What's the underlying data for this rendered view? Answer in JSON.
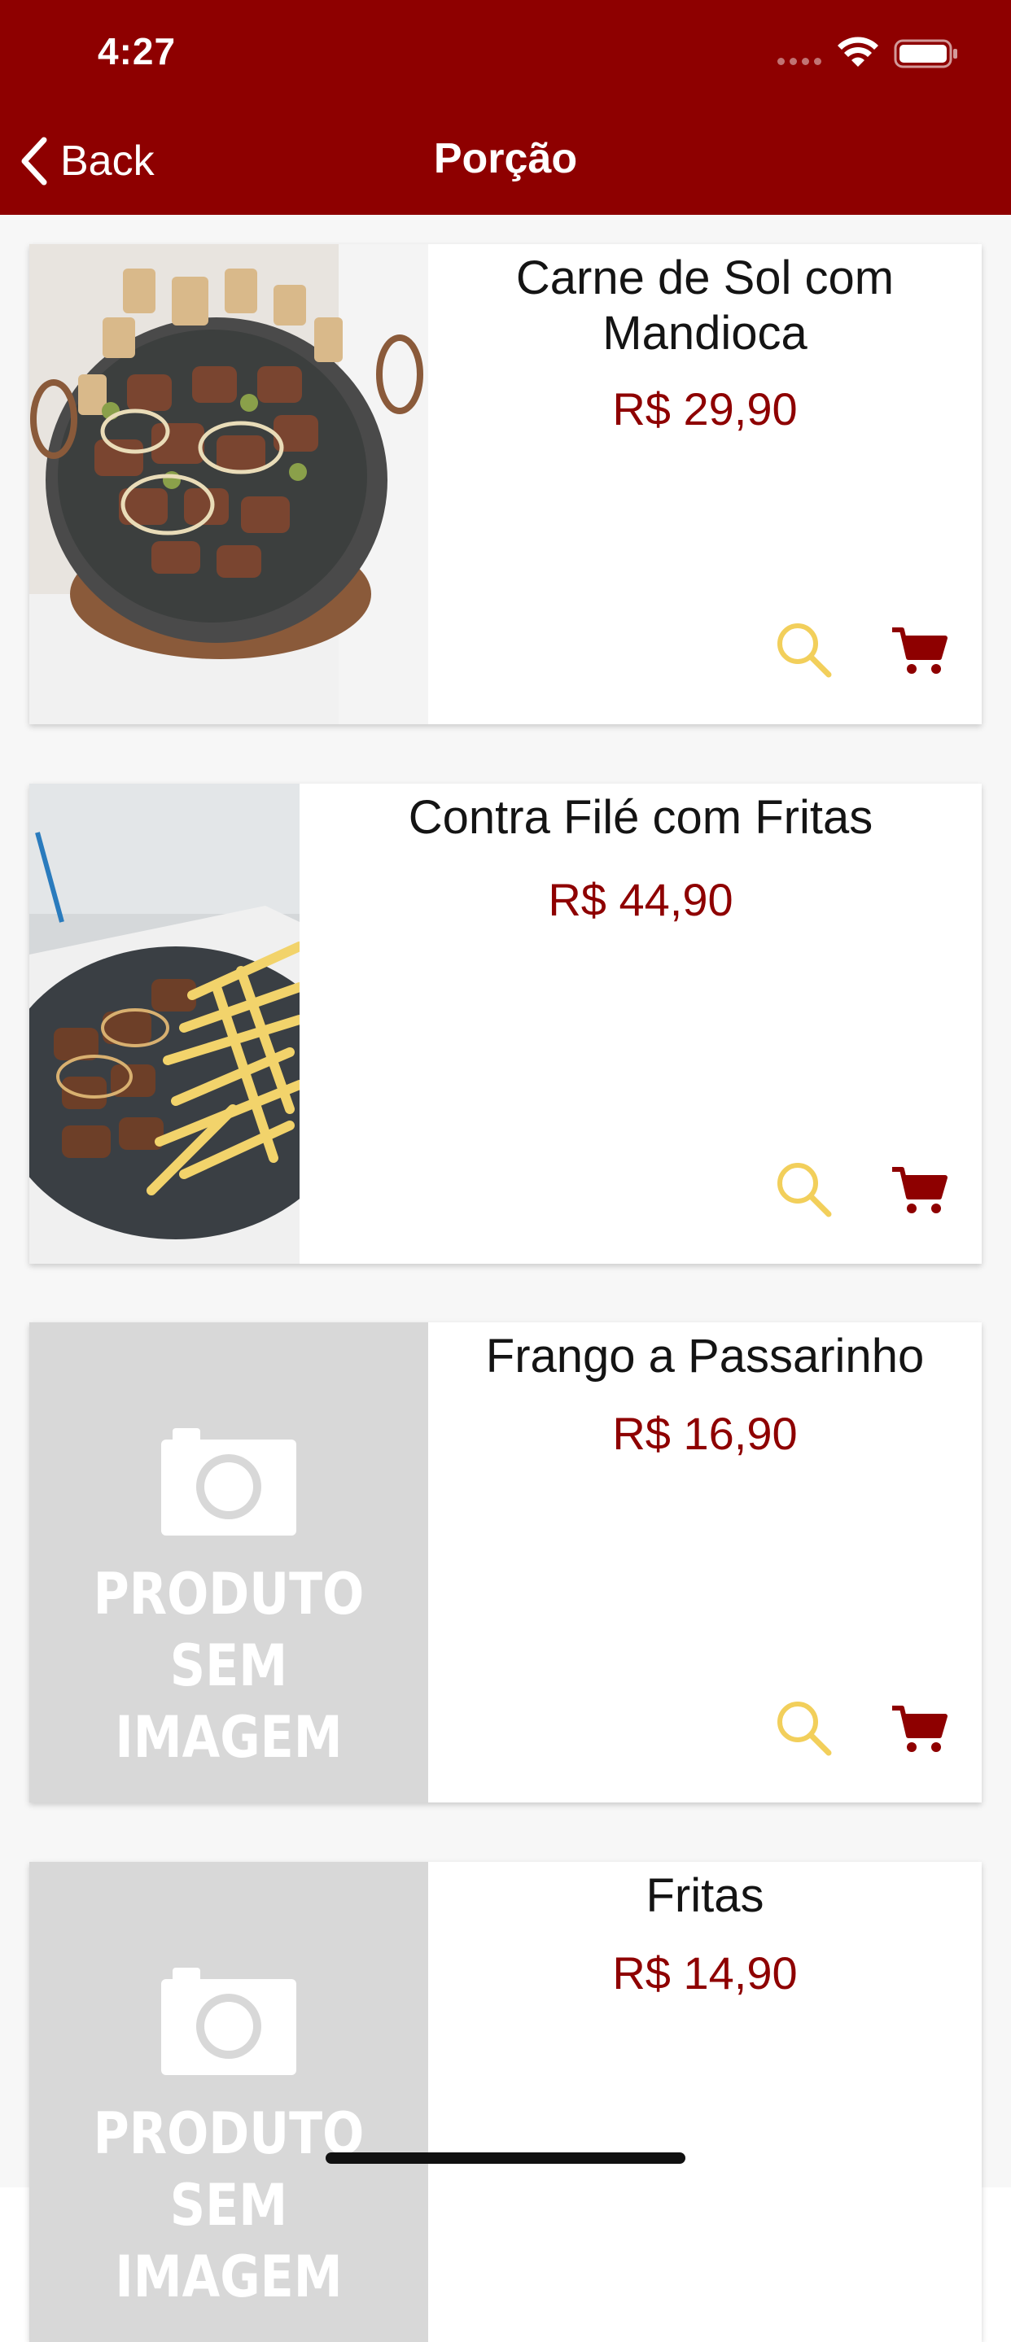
{
  "status_bar": {
    "time": "4:27"
  },
  "nav": {
    "back_label": "Back",
    "title": "Porção"
  },
  "no_image": {
    "line1": "PRODUTO",
    "line2": "SEM IMAGEM"
  },
  "products": [
    {
      "name": "Carne de Sol com Mandioca",
      "price": "R$ 29,90"
    },
    {
      "name": "Contra Filé com Fritas",
      "price": "R$ 44,90"
    },
    {
      "name": "Frango a Passarinho",
      "price": "R$ 16,90"
    },
    {
      "name": "Fritas",
      "price": "R$ 14,90"
    }
  ],
  "colors": {
    "brand": "#8e0000",
    "search_icon": "#f2cf5b",
    "background": "#f7f7f7"
  },
  "icons": [
    "chevron-left-icon",
    "wifi-icon",
    "battery-icon",
    "search-icon",
    "cart-icon",
    "camera-icon"
  ]
}
